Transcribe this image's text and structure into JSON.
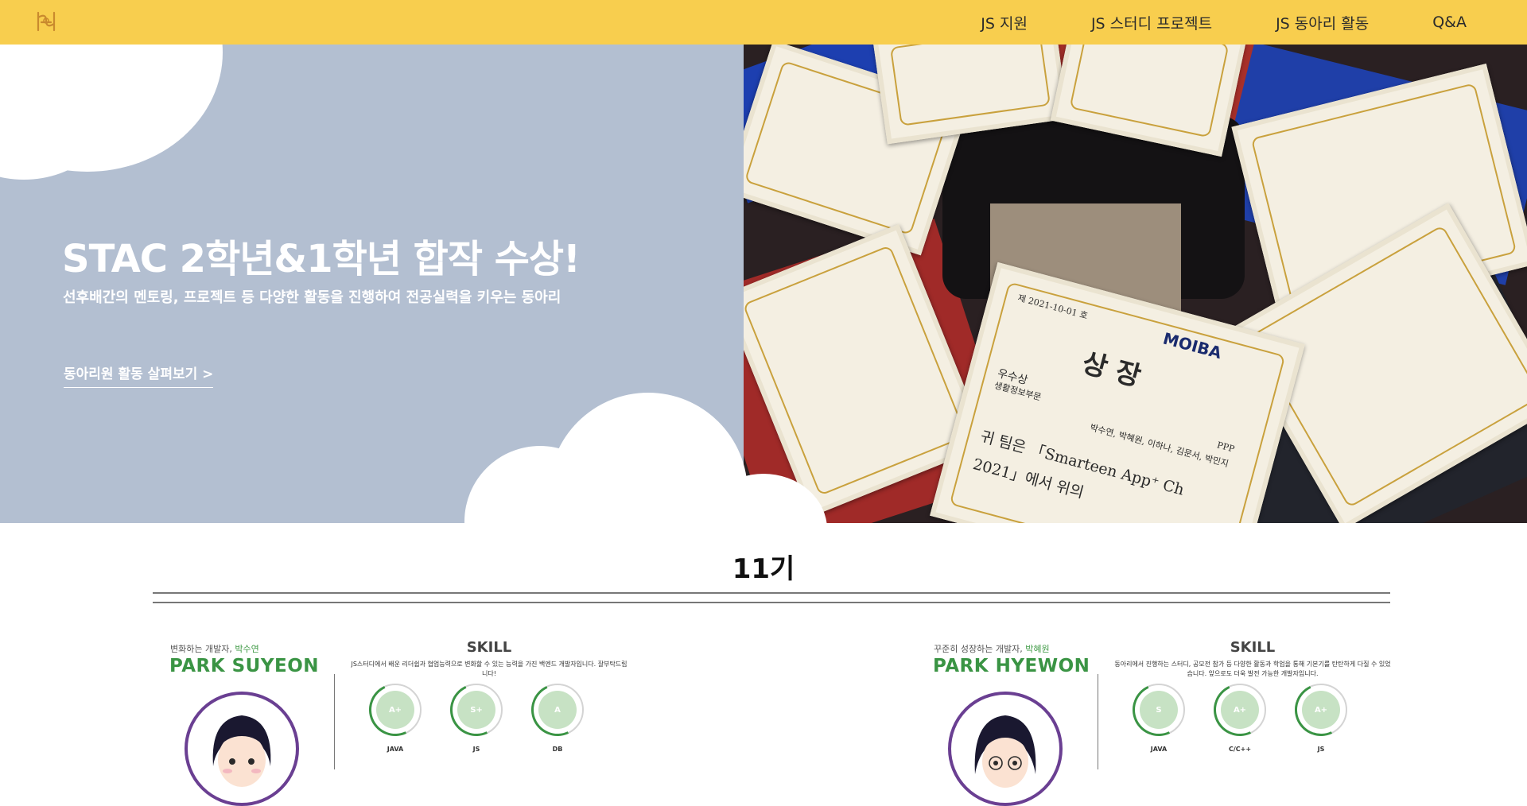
{
  "nav": {
    "items": [
      "JS 지원",
      "JS 스터디 프로젝트",
      "JS 동아리 활동",
      "Q&A"
    ]
  },
  "hero": {
    "title": "STAC 2학년&1학년 합작 수상!",
    "subtitle": "선후배간의 멘토링, 프로젝트 등 다양한 활동을 진행하여 전공실력을 키우는 동아리",
    "link": "동아리원 활동 살펴보기  >",
    "certificate": {
      "org": "MOIBA",
      "date": "제 2021-10-01 호",
      "heading": "상  장",
      "award": "우수상",
      "dept": "생활정보부문",
      "team": "PPP",
      "members": "박수연, 박혜원, 이하나, 김문서, 박민지",
      "body1": "귀 팀은 「Smarteen App⁺ Ch",
      "body2": "2021」에서 위의"
    }
  },
  "generation": {
    "title": "11기"
  },
  "profiles": [
    {
      "tagline_prefix": "변화하는 개발자,",
      "tagline_name": "박수연",
      "name": "PARK SUYEON",
      "skill_title": "SKILL",
      "skill_desc": "JS스터디에서 배운 리더쉽과 협업능력으로 변화할 수 있는 능력을 가진 백엔드 개발자입니다. 잘부탁드립니다!",
      "skills": [
        {
          "grade": "A+",
          "label": "JAVA"
        },
        {
          "grade": "S+",
          "label": "JS"
        },
        {
          "grade": "A",
          "label": "DB"
        }
      ]
    },
    {
      "tagline_prefix": "꾸준히 성장하는 개발자,",
      "tagline_name": "박혜원",
      "name": "PARK HYEWON",
      "skill_title": "SKILL",
      "skill_desc": "동아리에서 진행하는 스터디, 공모전 참가 등 다양한 활동과 학업을 통해 기본기를 탄탄하게 다질 수 있었습니다. 앞으로도 더욱 발전 가능한 개발자입니다.",
      "skills": [
        {
          "grade": "S",
          "label": "JAVA"
        },
        {
          "grade": "A+",
          "label": "C/C++"
        },
        {
          "grade": "A+",
          "label": "JS"
        }
      ]
    }
  ],
  "colors": {
    "nav_bg": "#f8ce4e",
    "hero_left_bg": "#b3bfd1",
    "accent_green": "#3a9444",
    "avatar_ring": "#6a3f92"
  },
  "icons": {
    "logo": "club-logo-icon"
  }
}
